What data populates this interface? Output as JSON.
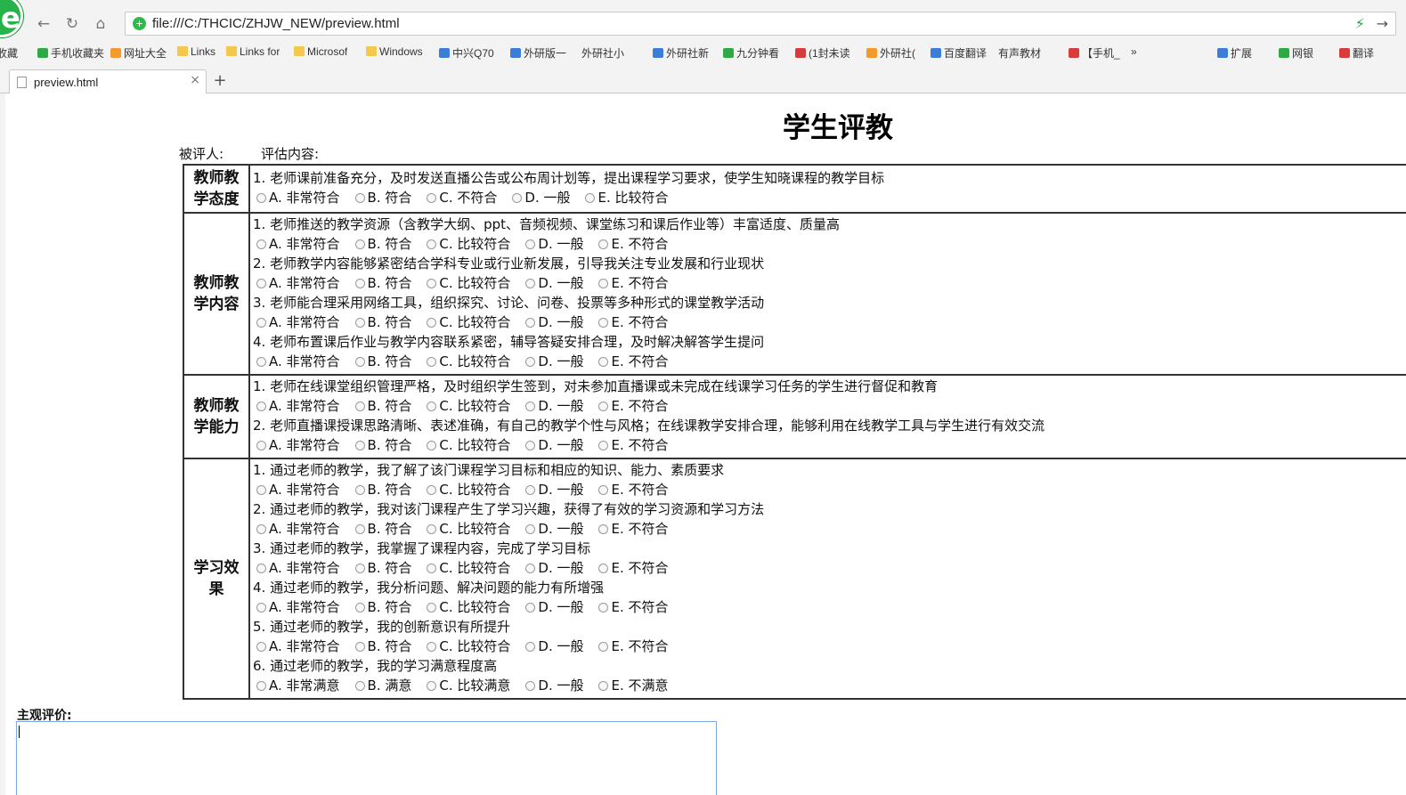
{
  "browser": {
    "url": "file:///C:/THCIC/ZHJW_NEW/preview.html",
    "tab_title": "preview.html",
    "close_tab": "×",
    "new_tab": "+",
    "bookmarks": [
      {
        "label": "收藏",
        "icon": "none"
      },
      {
        "label": "手机收藏夹",
        "icon": "green"
      },
      {
        "label": "网址大全",
        "icon": "orange"
      },
      {
        "label": "Links",
        "icon": "folder"
      },
      {
        "label": "Links for",
        "icon": "folder"
      },
      {
        "label": "Microsof",
        "icon": "folder"
      },
      {
        "label": "Windows",
        "icon": "folder"
      },
      {
        "label": "中兴Q70",
        "icon": "blue"
      },
      {
        "label": "外研版一",
        "icon": "blue"
      },
      {
        "label": "外研社小",
        "icon": "page"
      },
      {
        "label": "外研社新",
        "icon": "blue"
      },
      {
        "label": "九分钟看",
        "icon": "green"
      },
      {
        "label": "(1封未读",
        "icon": "red"
      },
      {
        "label": "外研社(",
        "icon": "orange"
      },
      {
        "label": "百度翻译",
        "icon": "blue"
      },
      {
        "label": "有声教材",
        "icon": "page"
      },
      {
        "label": "【手机_",
        "icon": "red"
      },
      {
        "label": "»",
        "icon": "none"
      },
      {
        "label": "扩展",
        "icon": "blue"
      },
      {
        "label": "网银",
        "icon": "green"
      },
      {
        "label": "翻译",
        "icon": "red"
      }
    ]
  },
  "page": {
    "title": "学生评教",
    "evaluatee_label": "被评人:",
    "content_label": "评估内容:",
    "subjective_label": "主观评价:",
    "subjective_value": ""
  },
  "sections": [
    {
      "category": "教师教学态度",
      "questions": [
        {
          "text": "1. 老师课前准备充分，及时发送直播公告或公布周计划等，提出课程学习要求，使学生知晓课程的教学目标",
          "options": [
            "A. 非常符合",
            "B. 符合",
            "C. 不符合",
            "D. 一般",
            "E. 比较符合"
          ]
        }
      ]
    },
    {
      "category": "教师教学内容",
      "questions": [
        {
          "text": "1. 老师推送的教学资源（含教学大纲、ppt、音频视频、课堂练习和课后作业等）丰富适度、质量高",
          "options": [
            "A. 非常符合",
            "B. 符合",
            "C. 比较符合",
            "D. 一般",
            "E. 不符合"
          ]
        },
        {
          "text": "2. 老师教学内容能够紧密结合学科专业或行业新发展，引导我关注专业发展和行业现状",
          "options": [
            "A. 非常符合",
            "B. 符合",
            "C. 比较符合",
            "D. 一般",
            "E. 不符合"
          ]
        },
        {
          "text": "3. 老师能合理采用网络工具，组织探究、讨论、问卷、投票等多种形式的课堂教学活动",
          "options": [
            "A. 非常符合",
            "B. 符合",
            "C. 比较符合",
            "D. 一般",
            "E. 不符合"
          ]
        },
        {
          "text": "4. 老师布置课后作业与教学内容联系紧密，辅导答疑安排合理，及时解决解答学生提问",
          "options": [
            "A. 非常符合",
            "B. 符合",
            "C. 比较符合",
            "D. 一般",
            "E. 不符合"
          ]
        }
      ]
    },
    {
      "category": "教师教学能力",
      "questions": [
        {
          "text": "1. 老师在线课堂组织管理严格，及时组织学生签到，对未参加直播课或未完成在线课学习任务的学生进行督促和教育",
          "options": [
            "A. 非常符合",
            "B. 符合",
            "C. 比较符合",
            "D. 一般",
            "E. 不符合"
          ]
        },
        {
          "text": "2. 老师直播课授课思路清晰、表述准确，有自己的教学个性与风格；在线课教学安排合理，能够利用在线教学工具与学生进行有效交流",
          "options": [
            "A. 非常符合",
            "B. 符合",
            "C. 比较符合",
            "D. 一般",
            "E. 不符合"
          ]
        }
      ]
    },
    {
      "category": "学习效果",
      "questions": [
        {
          "text": "1. 通过老师的教学，我了解了该门课程学习目标和相应的知识、能力、素质要求",
          "options": [
            "A. 非常符合",
            "B. 符合",
            "C. 比较符合",
            "D. 一般",
            "E. 不符合"
          ]
        },
        {
          "text": "2. 通过老师的教学，我对该门课程产生了学习兴趣，获得了有效的学习资源和学习方法",
          "options": [
            "A. 非常符合",
            "B. 符合",
            "C. 比较符合",
            "D. 一般",
            "E. 不符合"
          ]
        },
        {
          "text": "3. 通过老师的教学，我掌握了课程内容，完成了学习目标",
          "options": [
            "A. 非常符合",
            "B. 符合",
            "C. 比较符合",
            "D. 一般",
            "E. 不符合"
          ]
        },
        {
          "text": "4. 通过老师的教学，我分析问题、解决问题的能力有所增强",
          "options": [
            "A. 非常符合",
            "B. 符合",
            "C. 比较符合",
            "D. 一般",
            "E. 不符合"
          ]
        },
        {
          "text": "5. 通过老师的教学，我的创新意识有所提升",
          "options": [
            "A. 非常符合",
            "B. 符合",
            "C. 比较符合",
            "D. 一般",
            "E. 不符合"
          ]
        },
        {
          "text": "6. 通过老师的教学，我的学习满意程度高",
          "options": [
            "A. 非常满意",
            "B. 满意",
            "C. 比较满意",
            "D. 一般",
            "E. 不满意"
          ]
        }
      ]
    }
  ]
}
